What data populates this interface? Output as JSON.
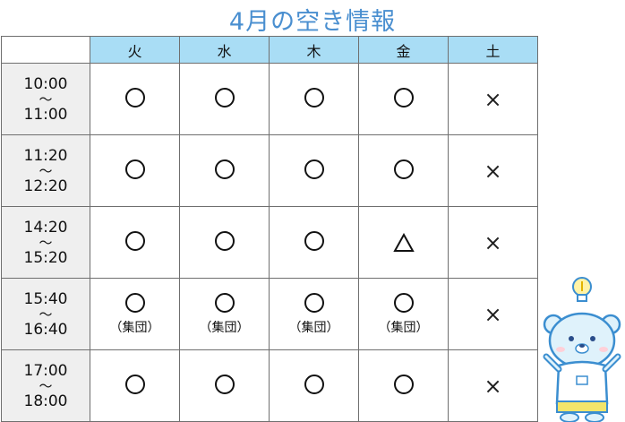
{
  "title": "4月の空き情報",
  "days": [
    "火",
    "水",
    "木",
    "金",
    "土"
  ],
  "rows": [
    {
      "time_start": "10:00",
      "tilde": "～",
      "time_end": "11:00",
      "cells": [
        {
          "mark": "circle"
        },
        {
          "mark": "circle"
        },
        {
          "mark": "circle"
        },
        {
          "mark": "circle"
        },
        {
          "mark": "cross",
          "text": "×"
        }
      ]
    },
    {
      "time_start": "11:20",
      "tilde": "～",
      "time_end": "12:20",
      "cells": [
        {
          "mark": "circle"
        },
        {
          "mark": "circle"
        },
        {
          "mark": "circle"
        },
        {
          "mark": "circle"
        },
        {
          "mark": "cross",
          "text": "×"
        }
      ]
    },
    {
      "time_start": "14:20",
      "tilde": "～",
      "time_end": "15:20",
      "cells": [
        {
          "mark": "circle"
        },
        {
          "mark": "circle"
        },
        {
          "mark": "circle"
        },
        {
          "mark": "triangle"
        },
        {
          "mark": "cross",
          "text": "×"
        }
      ]
    },
    {
      "time_start": "15:40",
      "tilde": "～",
      "time_end": "16:40",
      "cells": [
        {
          "mark": "circle",
          "note": "（集団）"
        },
        {
          "mark": "circle",
          "note": "（集団）"
        },
        {
          "mark": "circle",
          "note": "（集団）"
        },
        {
          "mark": "circle",
          "note": "（集団）"
        },
        {
          "mark": "cross",
          "text": "×"
        }
      ]
    },
    {
      "time_start": "17:00",
      "tilde": "～",
      "time_end": "18:00",
      "cells": [
        {
          "mark": "circle"
        },
        {
          "mark": "circle"
        },
        {
          "mark": "circle"
        },
        {
          "mark": "circle"
        },
        {
          "mark": "cross",
          "text": "×"
        }
      ]
    }
  ],
  "colors": {
    "title": "#4a8fd0",
    "header_bg": "#a9ddf5",
    "time_bg": "#efefef"
  }
}
